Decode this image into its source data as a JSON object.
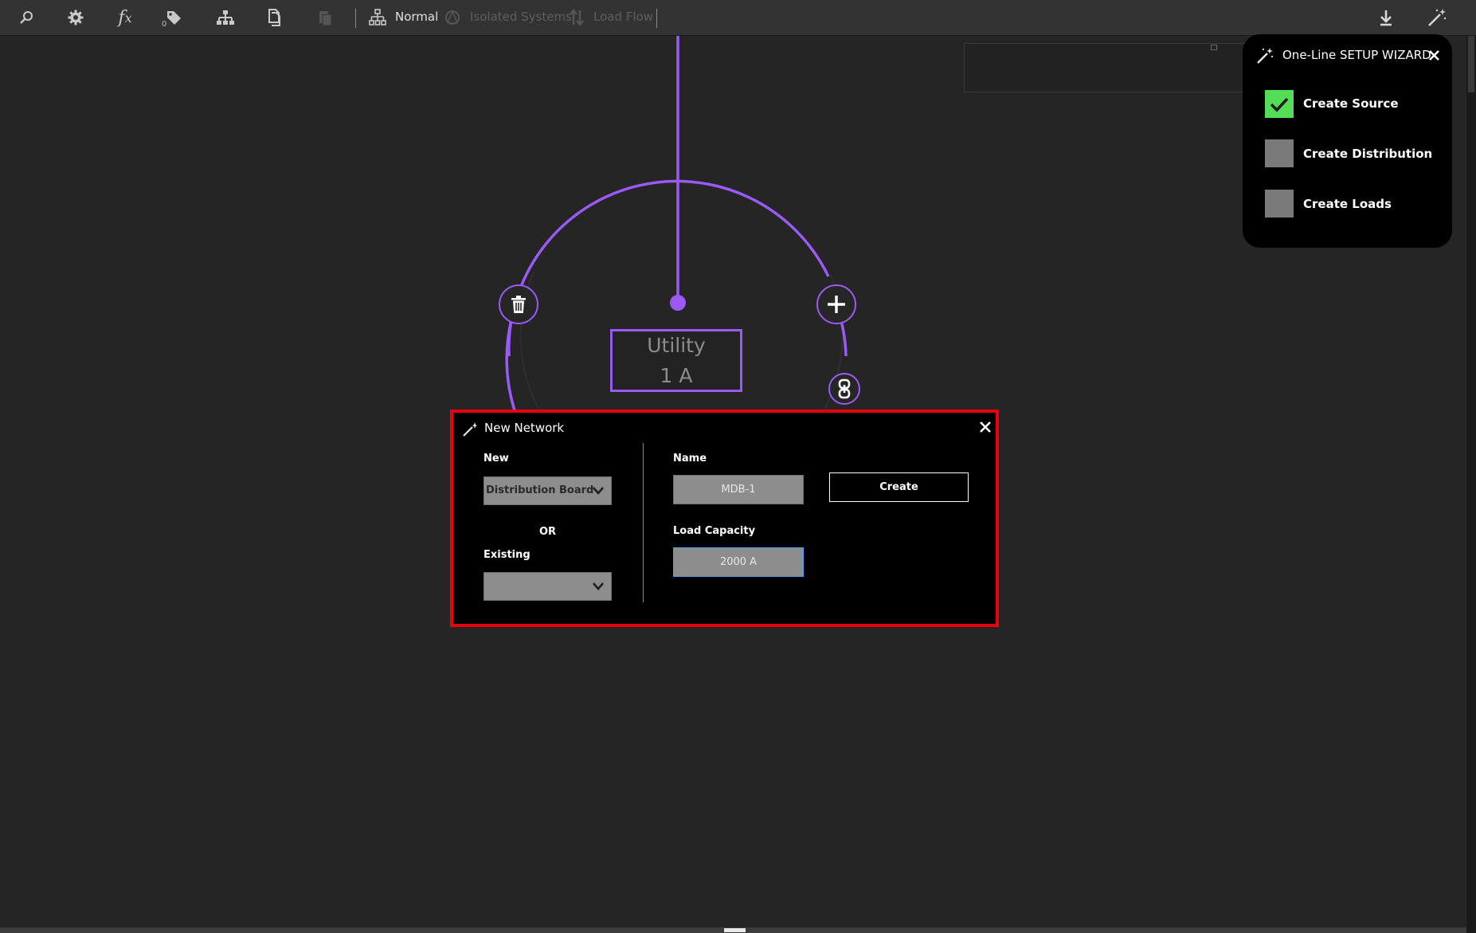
{
  "toolbar": {
    "tag_count": "0",
    "mode_normal": "Normal",
    "mode_isolated": "Isolated Systems",
    "mode_loadflow": "Load Flow"
  },
  "node": {
    "name": "Utility",
    "rating": "1 A"
  },
  "new_network": {
    "title": "New Network",
    "new_label": "New",
    "new_value": "Distribution Board",
    "or_label": "OR",
    "existing_label": "Existing",
    "existing_value": "",
    "name_label": "Name",
    "name_value": "MDB-1",
    "capacity_label": "Load Capacity",
    "capacity_value": "2000 A",
    "create_label": "Create"
  },
  "wizard": {
    "title": "One-Line  SETUP WIZARD",
    "steps": [
      {
        "label": "Create Source",
        "done": true
      },
      {
        "label": "Create Distribution",
        "done": false
      },
      {
        "label": "Create Loads",
        "done": false
      }
    ]
  },
  "colors": {
    "accent": "#9b59f5",
    "highlight": "#e8000b",
    "done": "#54de58"
  }
}
